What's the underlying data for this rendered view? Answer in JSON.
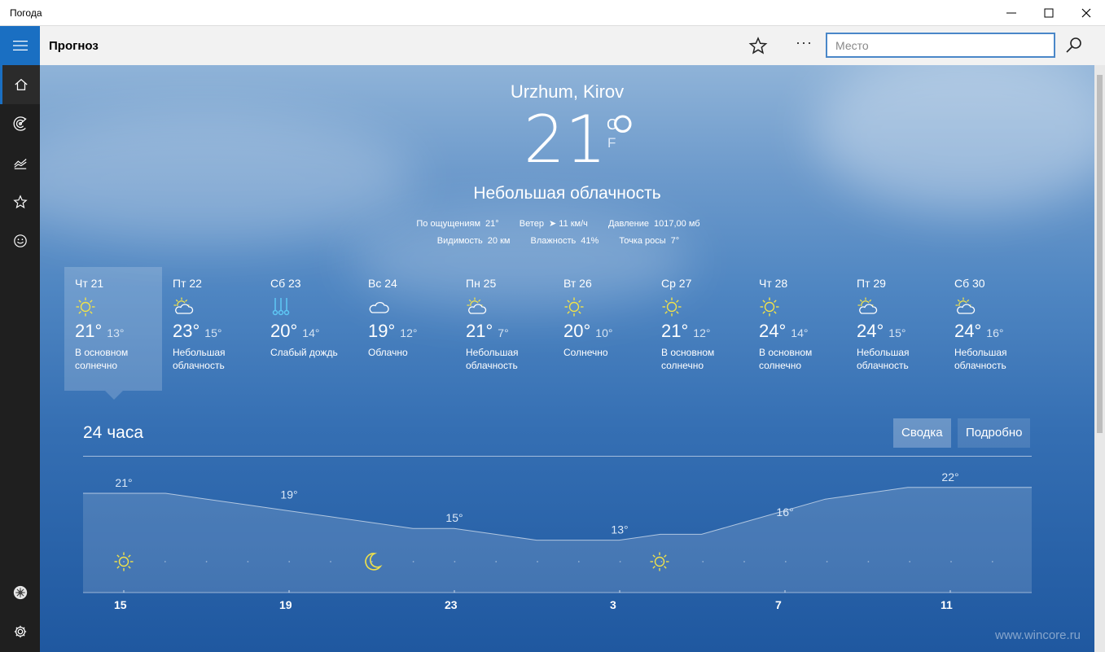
{
  "window": {
    "title": "Погода"
  },
  "header": {
    "title": "Прогноз",
    "search_placeholder": "Место"
  },
  "current": {
    "location": "Urzhum, Kirov",
    "temp": "21°",
    "unit_c": "C",
    "unit_f": "F",
    "condition": "Небольшая облачность",
    "details_row1": [
      {
        "k": "По ощущениям",
        "v": "21°"
      },
      {
        "k": "Ветер",
        "v": "➤ 11 км/ч"
      },
      {
        "k": "Давление",
        "v": "1017,00 мб"
      }
    ],
    "details_row2": [
      {
        "k": "Видимость",
        "v": "20 км"
      },
      {
        "k": "Влажность",
        "v": "41%"
      },
      {
        "k": "Точка росы",
        "v": "7°"
      }
    ]
  },
  "days": [
    {
      "name": "Чт 21",
      "icon": "sun-icon",
      "high": "21°",
      "low": "13°",
      "desc": "В основном солнечно"
    },
    {
      "name": "Пт 22",
      "icon": "partly-cloudy-icon",
      "high": "23°",
      "low": "15°",
      "desc": "Небольшая облачность"
    },
    {
      "name": "Сб 23",
      "icon": "rain-icon",
      "high": "20°",
      "low": "14°",
      "desc": "Слабый дождь"
    },
    {
      "name": "Вс 24",
      "icon": "cloud-icon",
      "high": "19°",
      "low": "12°",
      "desc": "Облачно"
    },
    {
      "name": "Пн 25",
      "icon": "partly-cloudy-icon",
      "high": "21°",
      "low": "7°",
      "desc": "Небольшая облачность"
    },
    {
      "name": "Вт 26",
      "icon": "sun-icon",
      "high": "20°",
      "low": "10°",
      "desc": "Солнечно"
    },
    {
      "name": "Ср 27",
      "icon": "sun-icon",
      "high": "21°",
      "low": "12°",
      "desc": "В основном солнечно"
    },
    {
      "name": "Чт 28",
      "icon": "sun-icon",
      "high": "24°",
      "low": "14°",
      "desc": "В основном солнечно"
    },
    {
      "name": "Пт 29",
      "icon": "partly-cloudy-icon",
      "high": "24°",
      "low": "15°",
      "desc": "Небольшая облачность"
    },
    {
      "name": "Сб 30",
      "icon": "partly-cloudy-icon",
      "high": "24°",
      "low": "16°",
      "desc": "Небольшая облачность"
    }
  ],
  "hourly": {
    "title": "24 часа",
    "btn_summary": "Сводка",
    "btn_detail": "Подробно",
    "labels": [
      {
        "x": "15",
        "temp": "21°"
      },
      {
        "x": "19",
        "temp": "19°"
      },
      {
        "x": "23",
        "temp": "15°"
      },
      {
        "x": "3",
        "temp": "13°"
      },
      {
        "x": "7",
        "temp": "16°"
      },
      {
        "x": "11",
        "temp": "22°"
      }
    ],
    "icons": [
      "sun-icon",
      "moon-icon",
      "sun-icon"
    ]
  },
  "chart_data": {
    "type": "area",
    "x": [
      "15",
      "16",
      "17",
      "18",
      "19",
      "20",
      "21",
      "22",
      "23",
      "0",
      "1",
      "2",
      "3",
      "4",
      "5",
      "6",
      "7",
      "8",
      "9",
      "10",
      "11",
      "12",
      "13"
    ],
    "series": [
      {
        "values": [
          21,
          21,
          21,
          20,
          19,
          18,
          17,
          16,
          15,
          15,
          14,
          13,
          13,
          13,
          14,
          14,
          16,
          18,
          20,
          21,
          22,
          22,
          22
        ]
      }
    ]
  },
  "watermark": "www.wincore.ru",
  "colors": {
    "accent": "#1a6fc2",
    "rail": "#1f1f1f",
    "sun": "#f1e24a"
  }
}
